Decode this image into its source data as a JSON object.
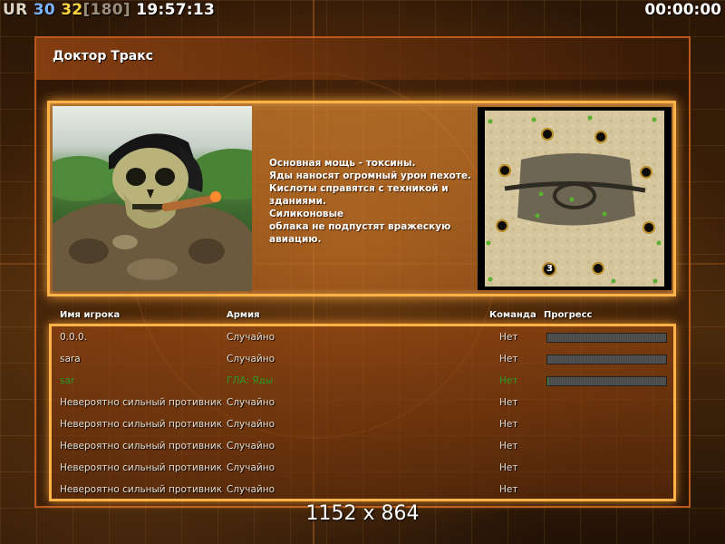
{
  "hud": {
    "ur": "UR",
    "num1": "30",
    "num2": "32",
    "bracket_value": "[180]",
    "clock": "19:57:13",
    "timer": "00:00:00"
  },
  "title": "Доктор Тракс",
  "description": [
    "Основная мощь - токсины.",
    "Яды наносят огромный урон пехоте.",
    "Кислоты справятся с техникой и",
    " зданиями.",
    "Силиконовые",
    "облака не подпустят вражескую",
    " авиацию."
  ],
  "minimap": {
    "player_marker": "3",
    "colors": {
      "sand": "#d9c9a0",
      "dark": "#4a4638",
      "accent_green": "#5ab030"
    }
  },
  "table": {
    "headers": {
      "name": "Имя игрока",
      "army": "Армия",
      "team": "Команда",
      "progress": "Прогресс"
    },
    "rows": [
      {
        "name": "0.0.0.",
        "army": "Случайно",
        "team": "Нет",
        "progress": 0.0,
        "highlight": false
      },
      {
        "name": "sara",
        "army": "Случайно",
        "team": "Нет",
        "progress": 0.0,
        "highlight": false
      },
      {
        "name": "sar",
        "army": "ГЛА: Яды",
        "team": "Нет",
        "progress": 0.01,
        "highlight": true
      },
      {
        "name": "Невероятно сильный противник",
        "army": "Случайно",
        "team": "Нет",
        "highlight": false
      },
      {
        "name": "Невероятно сильный противник",
        "army": "Случайно",
        "team": "Нет",
        "highlight": false
      },
      {
        "name": "Невероятно сильный противник",
        "army": "Случайно",
        "team": "Нет",
        "highlight": false
      },
      {
        "name": "Невероятно сильный противник",
        "army": "Случайно",
        "team": "Нет",
        "highlight": false
      },
      {
        "name": "Невероятно сильный противник",
        "army": "Случайно",
        "team": "Нет",
        "highlight": false
      }
    ]
  },
  "resolution": "1152 x 864",
  "colors": {
    "accent": "#ffb347",
    "player_green": "#2a9a25"
  }
}
